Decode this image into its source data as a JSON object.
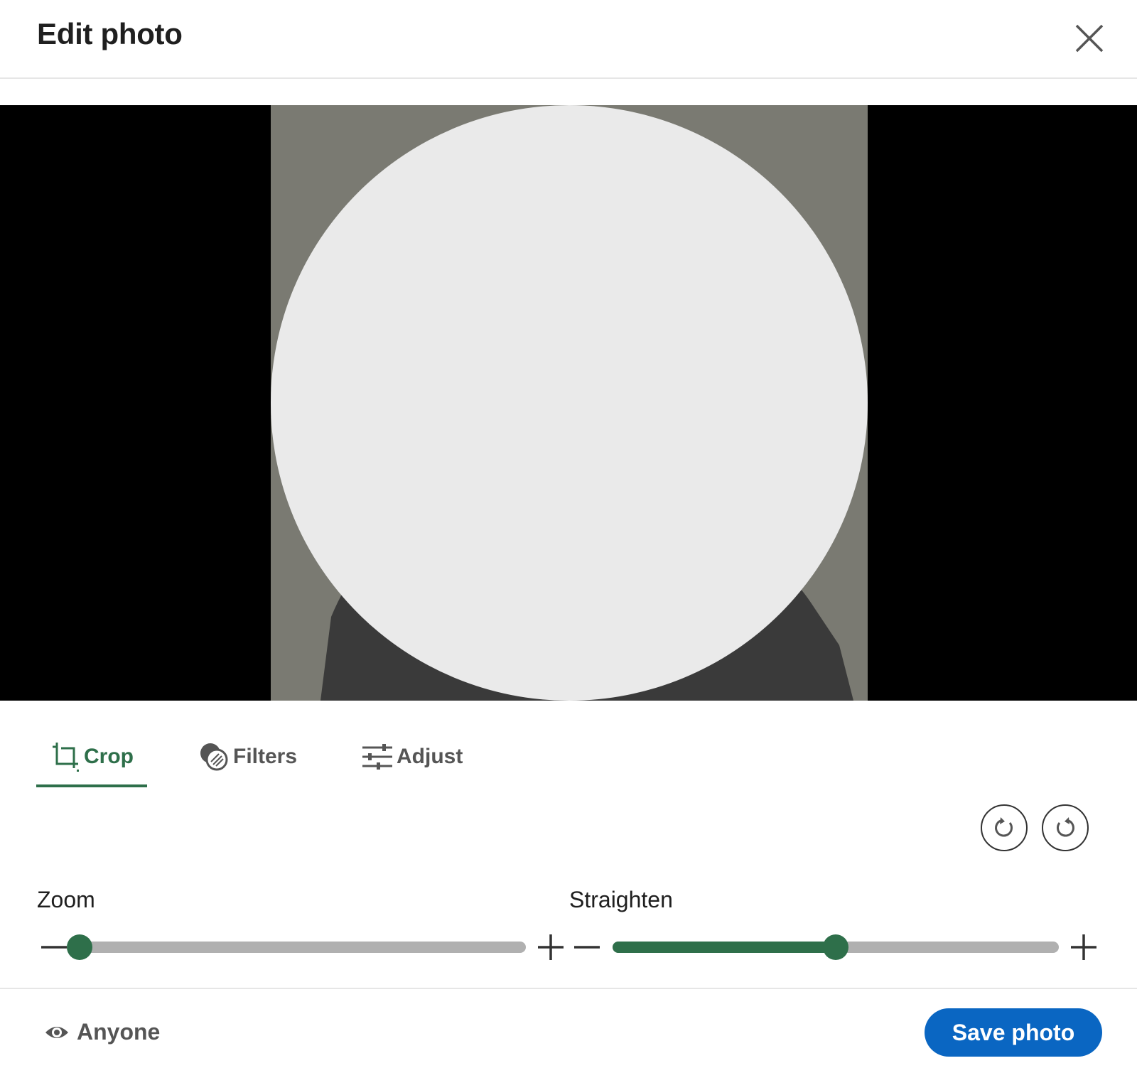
{
  "header": {
    "title": "Edit photo",
    "close_icon": "close-icon"
  },
  "colors": {
    "accent": "#2e6f4a",
    "primary_button": "#0a66c2",
    "stage_background": "#000000"
  },
  "tabs": [
    {
      "label": "Crop",
      "icon": "crop-icon",
      "active": true
    },
    {
      "label": "Filters",
      "icon": "filters-icon",
      "active": false
    },
    {
      "label": "Adjust",
      "icon": "adjust-icon",
      "active": false
    }
  ],
  "rotate": {
    "clockwise_icon": "rotate-clockwise-icon",
    "counterclockwise_icon": "rotate-counterclockwise-icon"
  },
  "sliders": {
    "zoom": {
      "label": "Zoom",
      "value": 0.0
    },
    "straighten": {
      "label": "Straighten",
      "value": 0.5
    }
  },
  "footer": {
    "visibility_label": "Anyone",
    "visibility_icon": "eye-icon",
    "save_label": "Save photo"
  }
}
